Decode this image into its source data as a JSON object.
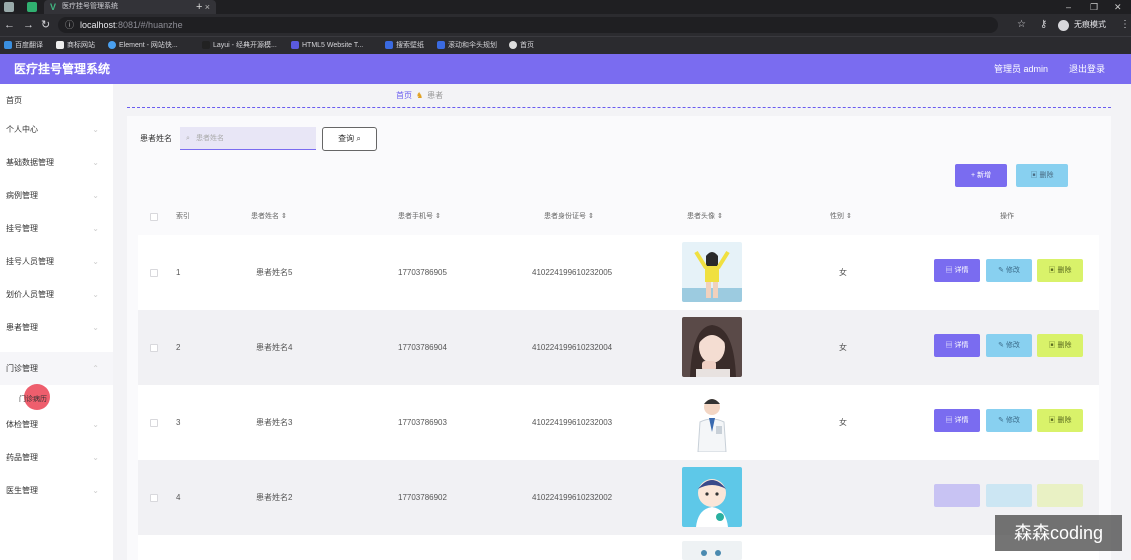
{
  "browser": {
    "tab_title": "医疗挂号管理系统",
    "tab_close": "×",
    "new_tab": "+",
    "url_host": "localhost",
    "url_rest": ":8081/#/huanzhe",
    "incognito_label": "无痕模式",
    "bookmarks": [
      "百度翻译",
      "商标网站",
      "Element - 网站快...",
      "Layui - 经典开源模...",
      "HTML5 Website T...",
      "搜索壁纸",
      "滚动和伞头规划",
      "首页"
    ]
  },
  "header": {
    "title": "医疗挂号管理系统",
    "user_label": "管理员 admin",
    "logout_label": "退出登录"
  },
  "sidebar": {
    "items": [
      "首页",
      "个人中心",
      "基础数据管理",
      "病例管理",
      "挂号管理",
      "挂号人员管理",
      "划价人员管理",
      "患者管理",
      "门诊管理",
      "体检管理",
      "药品管理",
      "医生管理"
    ],
    "sub_item": "门诊病历"
  },
  "breadcrumb": {
    "home": "首页",
    "current": "患者"
  },
  "search": {
    "label": "患者姓名",
    "placeholder": "患者姓名",
    "query_label": "查询"
  },
  "toolbar": {
    "add_label": "+ 新增",
    "delete_label": "删除"
  },
  "table": {
    "headers": {
      "index": "索引",
      "name": "患者姓名",
      "phone": "患者手机号",
      "idcard": "患者身份证号",
      "avatar": "患者头像",
      "gender": "性别",
      "actions": "操作"
    },
    "rows": [
      {
        "index": "1",
        "name": "患者姓名5",
        "phone": "17703786905",
        "idcard": "410224199610232005",
        "gender": "女"
      },
      {
        "index": "2",
        "name": "患者姓名4",
        "phone": "17703786904",
        "idcard": "410224199610232004",
        "gender": "女"
      },
      {
        "index": "3",
        "name": "患者姓名3",
        "phone": "17703786903",
        "idcard": "410224199610232003",
        "gender": "女"
      },
      {
        "index": "4",
        "name": "患者姓名2",
        "phone": "17703786902",
        "idcard": "410224199610232002",
        "gender": ""
      }
    ],
    "action_labels": {
      "detail": "详情",
      "edit": "修改",
      "remove": "删除"
    }
  },
  "watermark": "森森coding",
  "colors": {
    "primary": "#7a6cf0",
    "edit": "#88d0f0",
    "remove": "#d9f26a"
  }
}
